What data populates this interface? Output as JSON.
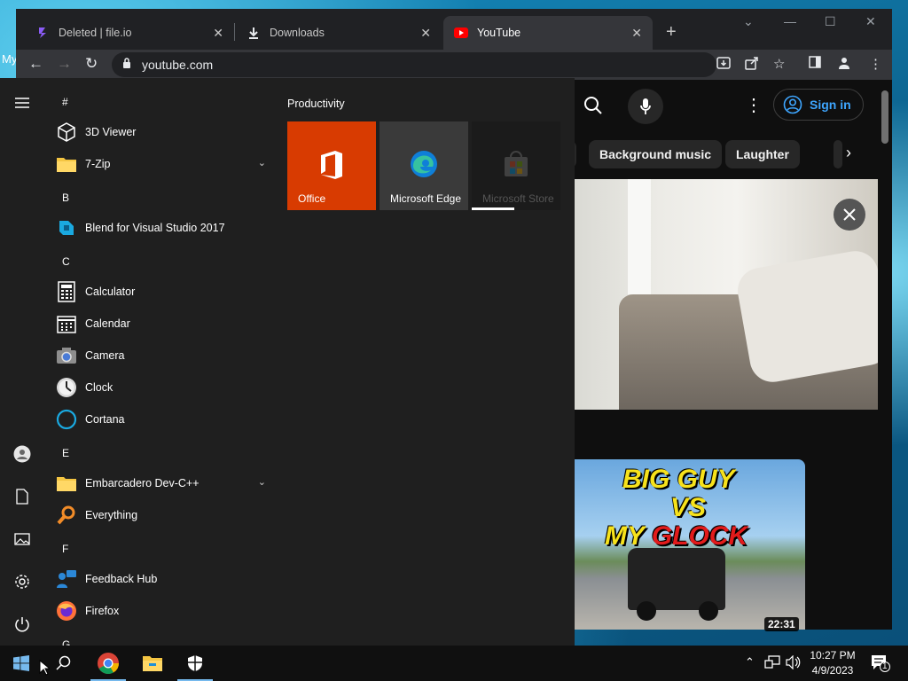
{
  "desktop": {
    "label": "My"
  },
  "browser": {
    "tabs": [
      {
        "title": "Deleted | file.io",
        "icon": "fileio-icon"
      },
      {
        "title": "Downloads",
        "icon": "download-icon"
      },
      {
        "title": "YouTube",
        "icon": "youtube-icon"
      }
    ],
    "url": "youtube.com"
  },
  "youtube": {
    "sign_in": "Sign in",
    "chips": [
      "Background music",
      "Laughter"
    ],
    "thumb_lines": [
      "BIG GUY",
      "VS",
      "MY",
      "GLOCK"
    ],
    "duration": "22:31"
  },
  "start_menu": {
    "apps": [
      {
        "type": "letter",
        "label": "#"
      },
      {
        "type": "app",
        "label": "3D Viewer",
        "icon": "cube-icon"
      },
      {
        "type": "app",
        "label": "7-Zip",
        "icon": "folder-icon",
        "expandable": true
      },
      {
        "type": "letter",
        "label": "B"
      },
      {
        "type": "app",
        "label": "Blend for Visual Studio 2017",
        "icon": "blend-icon"
      },
      {
        "type": "letter",
        "label": "C"
      },
      {
        "type": "app",
        "label": "Calculator",
        "icon": "calculator-icon"
      },
      {
        "type": "app",
        "label": "Calendar",
        "icon": "calendar-icon"
      },
      {
        "type": "app",
        "label": "Camera",
        "icon": "camera-icon"
      },
      {
        "type": "app",
        "label": "Clock",
        "icon": "clock-icon"
      },
      {
        "type": "app",
        "label": "Cortana",
        "icon": "cortana-icon"
      },
      {
        "type": "letter",
        "label": "E"
      },
      {
        "type": "app",
        "label": "Embarcadero Dev-C++",
        "icon": "folder-icon",
        "expandable": true
      },
      {
        "type": "app",
        "label": "Everything",
        "icon": "everything-icon"
      },
      {
        "type": "letter",
        "label": "F"
      },
      {
        "type": "app",
        "label": "Feedback Hub",
        "icon": "feedback-icon"
      },
      {
        "type": "app",
        "label": "Firefox",
        "icon": "firefox-icon"
      },
      {
        "type": "letter",
        "label": "G"
      }
    ],
    "group_title": "Productivity",
    "tiles": [
      {
        "label": "Office",
        "color": "#d83b01"
      },
      {
        "label": "Microsoft Edge",
        "color": "#3a3a3a"
      },
      {
        "label": "Microsoft Store",
        "color": "#1b1b1b"
      }
    ]
  },
  "taskbar": {
    "time": "10:27 PM",
    "date": "4/9/2023",
    "notification_count": "1"
  },
  "colors": {
    "accent": "#3ea6ff",
    "office": "#d83b01",
    "taskbar_indicator": "#76b9ed"
  }
}
